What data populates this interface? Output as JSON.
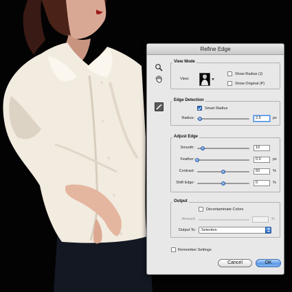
{
  "dialog": {
    "title": "Refine Edge",
    "view_mode": {
      "label": "View Mode",
      "view_label": "View:",
      "show_radius": "Show Radius (J)",
      "show_original": "Show Original (P)"
    },
    "edge_detection": {
      "label": "Edge Detection",
      "smart_radius": "Smart Radius",
      "radius_label": "Radius:",
      "radius_value": "2.5",
      "radius_unit": "px",
      "radius_level": 0.05
    },
    "adjust_edge": {
      "label": "Adjust Edge",
      "smooth_label": "Smooth:",
      "smooth_value": "10",
      "smooth_level": 0.1,
      "feather_label": "Feather:",
      "feather_value": "0.0",
      "feather_unit": "px",
      "feather_level": 0.0,
      "contrast_label": "Contrast:",
      "contrast_value": "50",
      "contrast_unit": "%",
      "contrast_level": 0.5,
      "shift_label": "Shift Edge:",
      "shift_value": "0",
      "shift_unit": "%",
      "shift_level": 0.5
    },
    "output": {
      "label": "Output",
      "decontaminate": "Decontaminate Colors",
      "amount_label": "Amount:",
      "amount_unit": "%",
      "output_to_label": "Output To:",
      "output_to_value": "Selection"
    },
    "remember": "Remember Settings",
    "cancel": "Cancel",
    "ok": "OK"
  },
  "icons": {
    "zoom": "zoom-tool-icon",
    "hand": "hand-tool-icon",
    "refine_brush": "refine-radius-brush-icon"
  },
  "colors": {
    "accent": "#3d7ad0",
    "dialog_bg": "#e8e8e8"
  }
}
